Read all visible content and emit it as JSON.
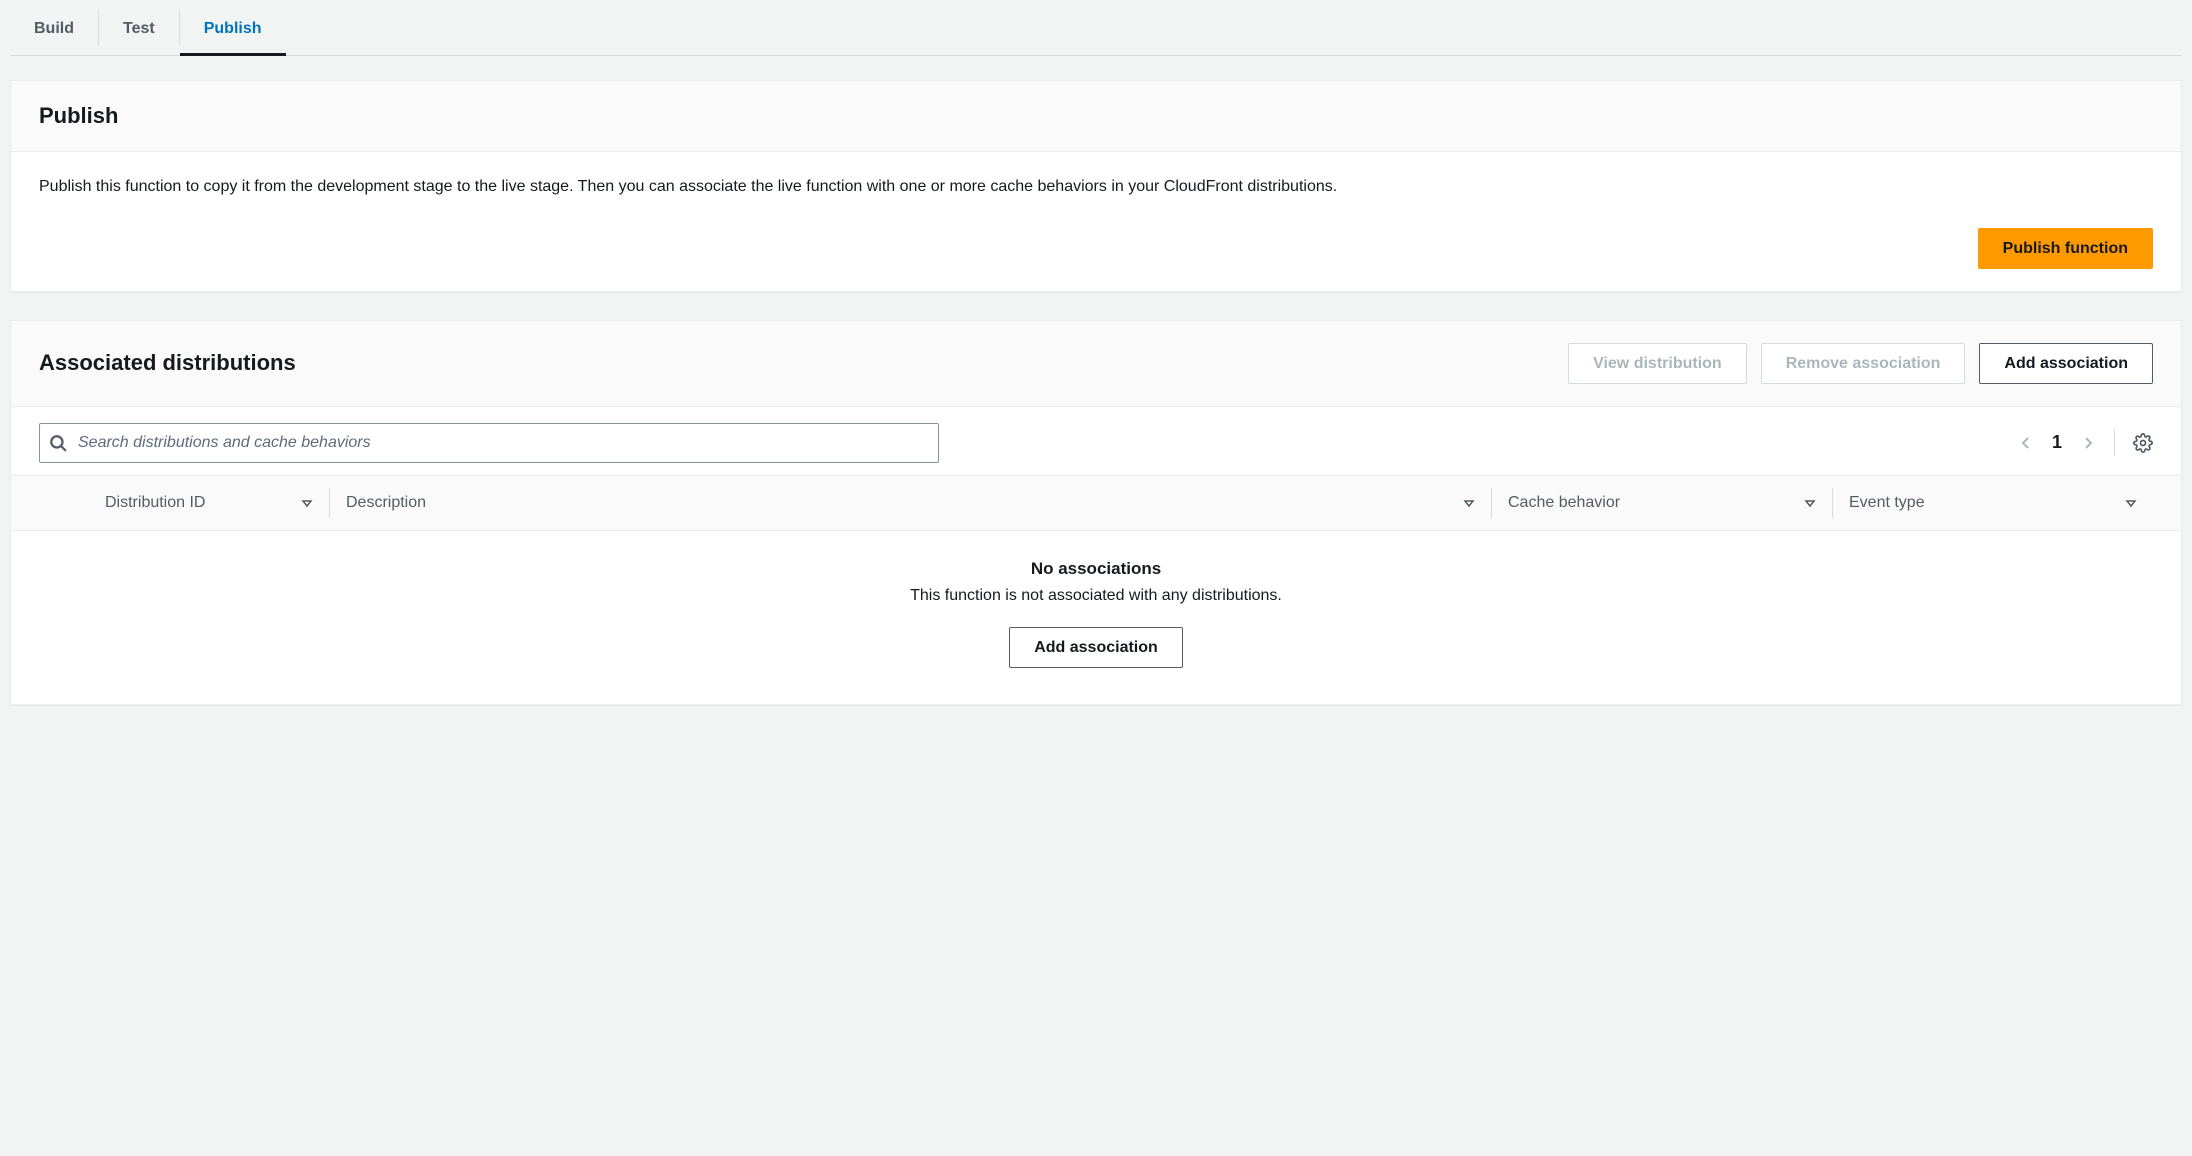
{
  "tabs": {
    "build": "Build",
    "test": "Test",
    "publish": "Publish"
  },
  "publish_panel": {
    "title": "Publish",
    "description": "Publish this function to copy it from the development stage to the live stage. Then you can associate the live function with one or more cache behaviors in your CloudFront distributions.",
    "button": "Publish function"
  },
  "assoc_panel": {
    "title": "Associated distributions",
    "view_btn": "View distribution",
    "remove_btn": "Remove association",
    "add_btn": "Add association",
    "search_placeholder": "Search distributions and cache behaviors",
    "page_current": "1",
    "columns": {
      "dist_id": "Distribution ID",
      "description": "Description",
      "cache_behavior": "Cache behavior",
      "event_type": "Event type"
    },
    "empty_title": "No associations",
    "empty_sub": "This function is not associated with any distributions.",
    "empty_btn": "Add association",
    "rows": []
  }
}
